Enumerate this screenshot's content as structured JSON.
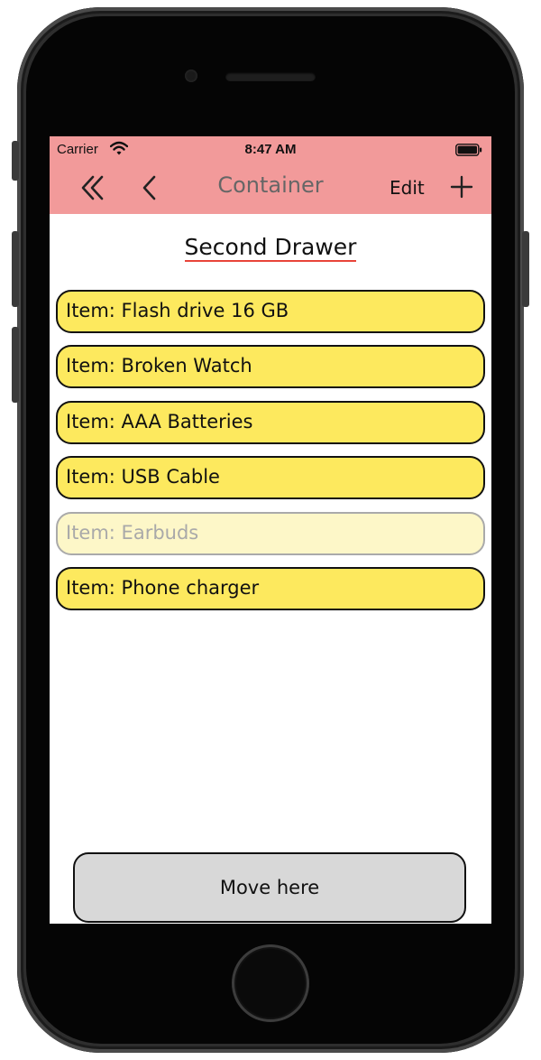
{
  "status_bar": {
    "carrier": "Carrier",
    "time": "8:47 AM"
  },
  "nav": {
    "title": "Container",
    "edit_label": "Edit",
    "icons": [
      "double-chevron-left-icon",
      "chevron-left-icon",
      "plus-icon"
    ]
  },
  "drawer_title": "Second Drawer",
  "items": [
    {
      "label": "Item: Flash drive 16 GB",
      "state": "normal"
    },
    {
      "label": "Item: Broken Watch",
      "state": "normal"
    },
    {
      "label": "Item: AAA Batteries",
      "state": "normal"
    },
    {
      "label": "Item: USB Cable",
      "state": "normal"
    },
    {
      "label": "Item: Earbuds",
      "state": "disabled"
    },
    {
      "label": "Item: Phone charger",
      "state": "normal"
    }
  ],
  "move_button_label": "Move here",
  "colors": {
    "header_bg": "#f29a9a",
    "item_bg": "#fde95e",
    "item_disabled_bg": "#fdf7c8",
    "title_underline": "#e8443a",
    "move_button_bg": "#d8d8d8"
  }
}
